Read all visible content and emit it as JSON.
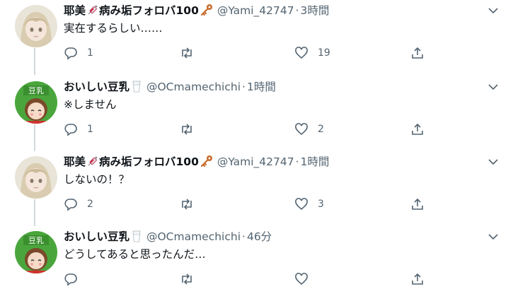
{
  "colors": {
    "text": "#0f1419",
    "secondary": "#536471",
    "line": "#cfd9de",
    "key": "#c96a2b",
    "bottle": "#d23048"
  },
  "tweets": [
    {
      "name": "耶美",
      "name_rest": "病み垢フォロバ100",
      "handle": "@Yami_42747",
      "sep": "·",
      "time": "3時間",
      "text": "実在するらしい……",
      "reply": "1",
      "retweet": "",
      "like": "19",
      "avatar": "girl-avatar"
    },
    {
      "name": "おいしい豆乳",
      "name_rest": "",
      "handle": "@OCmamechichi",
      "sep": "·",
      "time": "1時間",
      "text": "※しません",
      "reply": "1",
      "retweet": "",
      "like": "2",
      "avatar": "soymilk-avatar"
    },
    {
      "name": "耶美",
      "name_rest": "病み垢フォロバ100",
      "handle": "@Yami_42747",
      "sep": "·",
      "time": "1時間",
      "text": "しないの！？",
      "reply": "2",
      "retweet": "",
      "like": "3",
      "avatar": "girl-avatar"
    },
    {
      "name": "おいしい豆乳",
      "name_rest": "",
      "handle": "@OCmamechichi",
      "sep": "·",
      "time": "46分",
      "text": "どうしてあると思ったんだ…",
      "reply": "",
      "retweet": "",
      "like": "",
      "avatar": "soymilk-avatar"
    }
  ]
}
